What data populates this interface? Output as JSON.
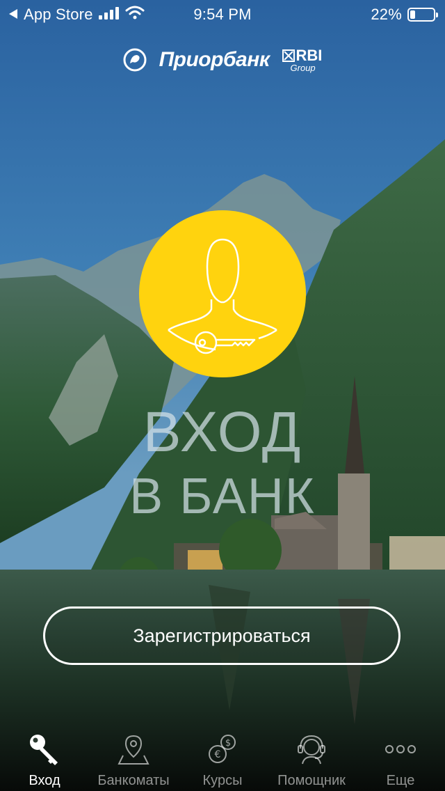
{
  "status_bar": {
    "back_label": "App Store",
    "time": "9:54 PM",
    "battery": "22%",
    "battery_level": 0.22
  },
  "brand": {
    "bank_name": "Приорбанк",
    "partner_top": "RBI",
    "partner_bottom": "Group"
  },
  "login": {
    "icon": "user-key-icon",
    "title_line1": "ВХОД",
    "title_line2": "В БАНК"
  },
  "register_label": "Зарегистрироваться",
  "tabs": [
    {
      "label": "Вход",
      "icon": "key-icon",
      "active": true
    },
    {
      "label": "Банкоматы",
      "icon": "map-pin-icon",
      "active": false
    },
    {
      "label": "Курсы",
      "icon": "currency-icon",
      "active": false
    },
    {
      "label": "Помощник",
      "icon": "headset-icon",
      "active": false
    },
    {
      "label": "Еще",
      "icon": "more-icon",
      "active": false
    }
  ],
  "colors": {
    "accent": "#ffd30e",
    "text": "#ffffff"
  }
}
